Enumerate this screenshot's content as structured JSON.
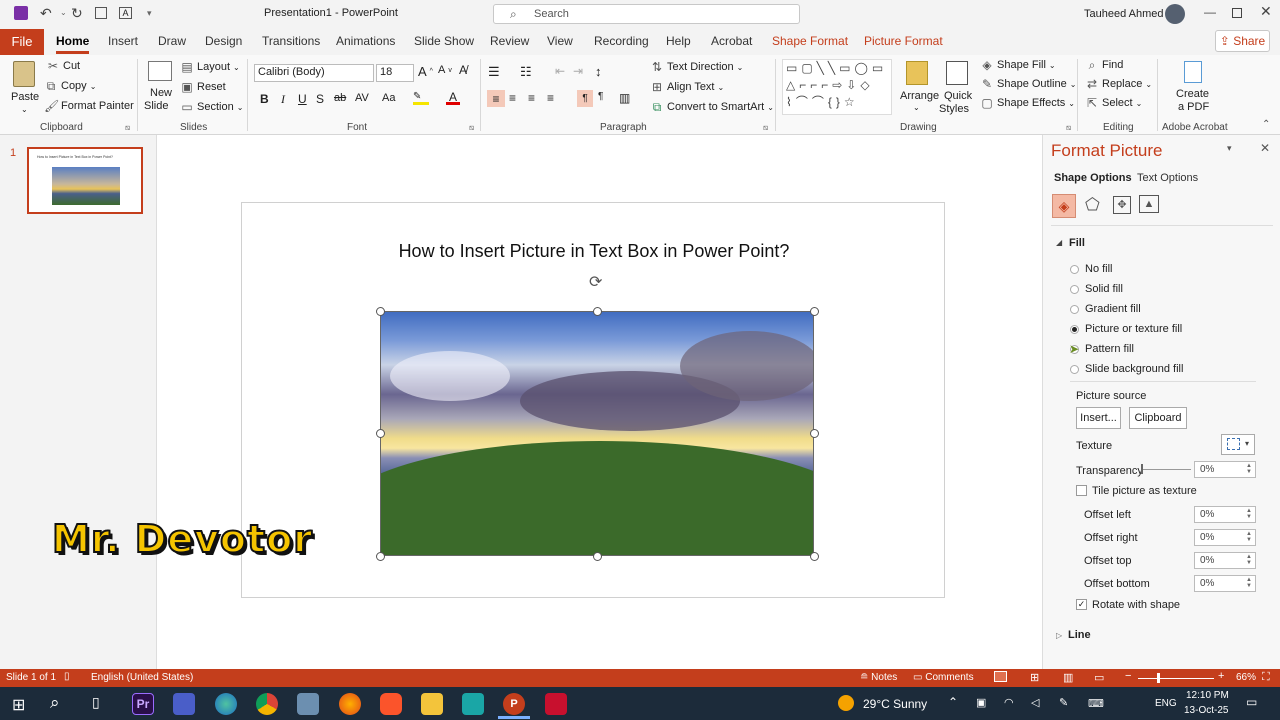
{
  "app": {
    "doc_title": "Presentation1",
    "app_name": "PowerPoint",
    "separator": "-",
    "search_placeholder": "Search",
    "user": "Tauheed Ahmed"
  },
  "tabs": [
    "File",
    "Home",
    "Insert",
    "Draw",
    "Design",
    "Transitions",
    "Animations",
    "Slide Show",
    "Review",
    "View",
    "Recording",
    "Help",
    "Acrobat",
    "Shape Format",
    "Picture Format"
  ],
  "share_label": "Share",
  "ribbon": {
    "clipboard": {
      "paste": "Paste",
      "cut": "Cut",
      "copy": "Copy",
      "format_painter": "Format Painter",
      "group": "Clipboard"
    },
    "slides": {
      "new_slide_1": "New",
      "new_slide_2": "Slide",
      "layout": "Layout",
      "reset": "Reset",
      "section": "Section",
      "group": "Slides"
    },
    "font": {
      "name": "Calibri (Body)",
      "size": "18",
      "group": "Font"
    },
    "paragraph": {
      "text_direction": "Text Direction",
      "align_text": "Align Text",
      "convert_smartart": "Convert to SmartArt",
      "group": "Paragraph"
    },
    "drawing": {
      "arrange": "Arrange",
      "quick_styles_1": "Quick",
      "quick_styles_2": "Styles",
      "shape_fill": "Shape Fill",
      "shape_outline": "Shape Outline",
      "shape_effects": "Shape Effects",
      "group": "Drawing"
    },
    "editing": {
      "find": "Find",
      "replace": "Replace",
      "select": "Select",
      "group": "Editing"
    },
    "acrobat": {
      "create_1": "Create",
      "create_2": "a PDF",
      "group": "Adobe Acrobat"
    }
  },
  "thumbnail": {
    "number": "1",
    "mini_title": "How to Insert Picture in Text Box in Power Point?"
  },
  "slide": {
    "title": "How to Insert Picture in Text Box in Power Point?"
  },
  "watermark": "Mr. Devotor",
  "pane": {
    "title": "Format Picture",
    "tab_shape": "Shape Options",
    "tab_text": "Text Options",
    "fill_header": "Fill",
    "options": [
      {
        "label": "No fill",
        "selected": false
      },
      {
        "label": "Solid fill",
        "selected": false
      },
      {
        "label": "Gradient fill",
        "selected": false
      },
      {
        "label": "Picture or texture fill",
        "selected": true
      },
      {
        "label": "Pattern fill",
        "selected": false
      },
      {
        "label": "Slide background fill",
        "selected": false
      }
    ],
    "picture_source": "Picture source",
    "insert_btn": "Insert...",
    "clipboard_btn": "Clipboard",
    "texture": "Texture",
    "transparency": "Transparency",
    "transparency_val": "0%",
    "tile": "Tile picture as texture",
    "offset_left": "Offset left",
    "offset_right": "Offset right",
    "offset_top": "Offset top",
    "offset_bottom": "Offset bottom",
    "offset_val": "0%",
    "rotate": "Rotate with shape",
    "line_header": "Line"
  },
  "status": {
    "slide": "Slide 1 of 1",
    "language": "English (United States)",
    "notes": "Notes",
    "comments": "Comments",
    "zoom": "66%"
  },
  "taskbar": {
    "weather": "29°C  Sunny",
    "lang": "ENG",
    "time": "12:10 PM",
    "date": "13-Oct-25"
  },
  "colors": {
    "accent": "#c43e1c",
    "taskbar": "#1c2b3a"
  }
}
